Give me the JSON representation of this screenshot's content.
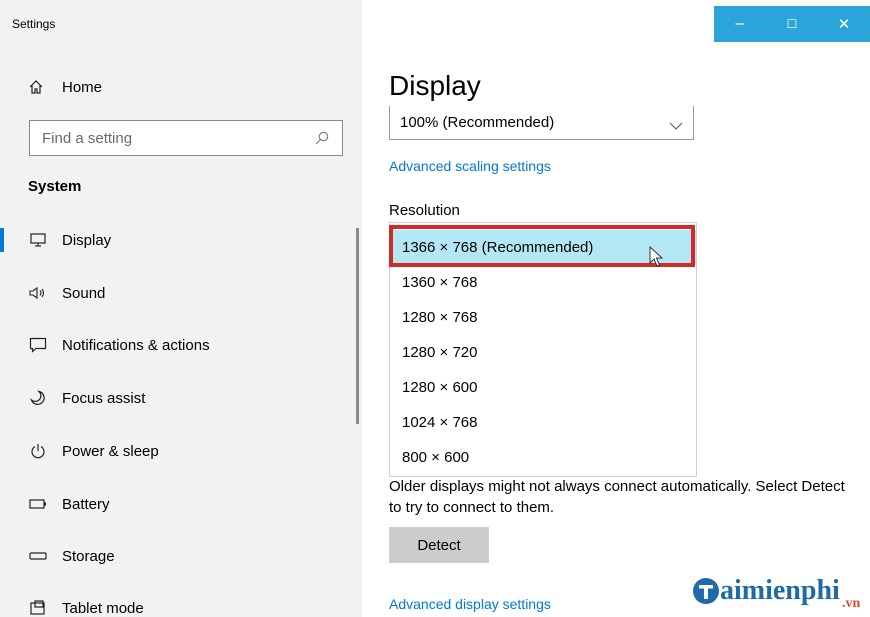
{
  "window": {
    "app_title": "Settings",
    "controls": {
      "minimize": "–",
      "maximize": "☐",
      "close": "✕"
    },
    "accent_color": "#0078d7"
  },
  "sidebar": {
    "home_label": "Home",
    "search_placeholder": "Find a setting",
    "section_title": "System",
    "items": [
      {
        "label": "Display",
        "icon": "monitor-icon",
        "active": true
      },
      {
        "label": "Sound",
        "icon": "speaker-icon"
      },
      {
        "label": "Notifications & actions",
        "icon": "message-icon"
      },
      {
        "label": "Focus assist",
        "icon": "moon-icon"
      },
      {
        "label": "Power & sleep",
        "icon": "power-icon"
      },
      {
        "label": "Battery",
        "icon": "battery-icon"
      },
      {
        "label": "Storage",
        "icon": "storage-icon"
      },
      {
        "label": "Tablet mode",
        "icon": "tablet-icon"
      }
    ]
  },
  "main": {
    "title": "Display",
    "scale_value": "100% (Recommended)",
    "advanced_scaling_link": "Advanced scaling settings",
    "resolution_label": "Resolution",
    "resolution_options": [
      "1366 × 768 (Recommended)",
      "1360 × 768",
      "1280 × 768",
      "1280 × 720",
      "1280 × 600",
      "1024 × 768",
      "800 × 600"
    ],
    "selected_resolution": "1366 × 768 (Recommended)",
    "detect_description": "Older displays might not always connect automatically. Select Detect to try to connect to them.",
    "detect_button": "Detect",
    "advanced_display_link": "Advanced display settings",
    "highlight_color": "#b3e7f5",
    "annotation_color": "#d12a2a"
  },
  "watermark": {
    "text": "aimienphi",
    "suffix": ".vn"
  }
}
